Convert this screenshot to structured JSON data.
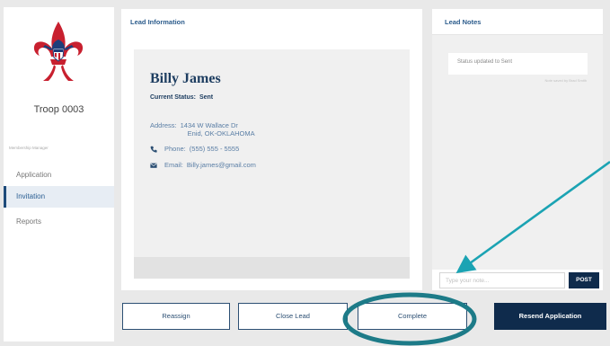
{
  "sidebar": {
    "troop_name": "Troop 0003",
    "section_label": "Membership Manager",
    "items": [
      {
        "label": "Application"
      },
      {
        "label": "Invitation"
      },
      {
        "label": "Reports"
      }
    ]
  },
  "lead_info": {
    "title": "Lead Information",
    "name": "Billy James",
    "status_label": "Current Status:",
    "status_value": "Sent",
    "address_label": "Address:",
    "address_line1": "1434 W Wallace Dr",
    "address_line2": "Enid, OK-OKLAHOMA",
    "phone_label": "Phone:",
    "phone_value": "(555) 555 - 5555",
    "email_label": "Email:",
    "email_value": "Billy.james@gmail.com"
  },
  "lead_notes": {
    "title": "Lead Notes",
    "note_text": "Status updated to Sent",
    "note_meta": "Note saved by Brad Smith",
    "input_placeholder": "Type your note...",
    "post_label": "POST"
  },
  "actions": {
    "reassign": "Reassign",
    "close_lead": "Close Lead",
    "complete": "Complete",
    "resend": "Resend Application"
  },
  "colors": {
    "navy": "#0f2b4c",
    "link_blue": "#2c5c8c",
    "annotation_teal": "#1d7b88",
    "arrow_teal": "#1ba3b3"
  }
}
